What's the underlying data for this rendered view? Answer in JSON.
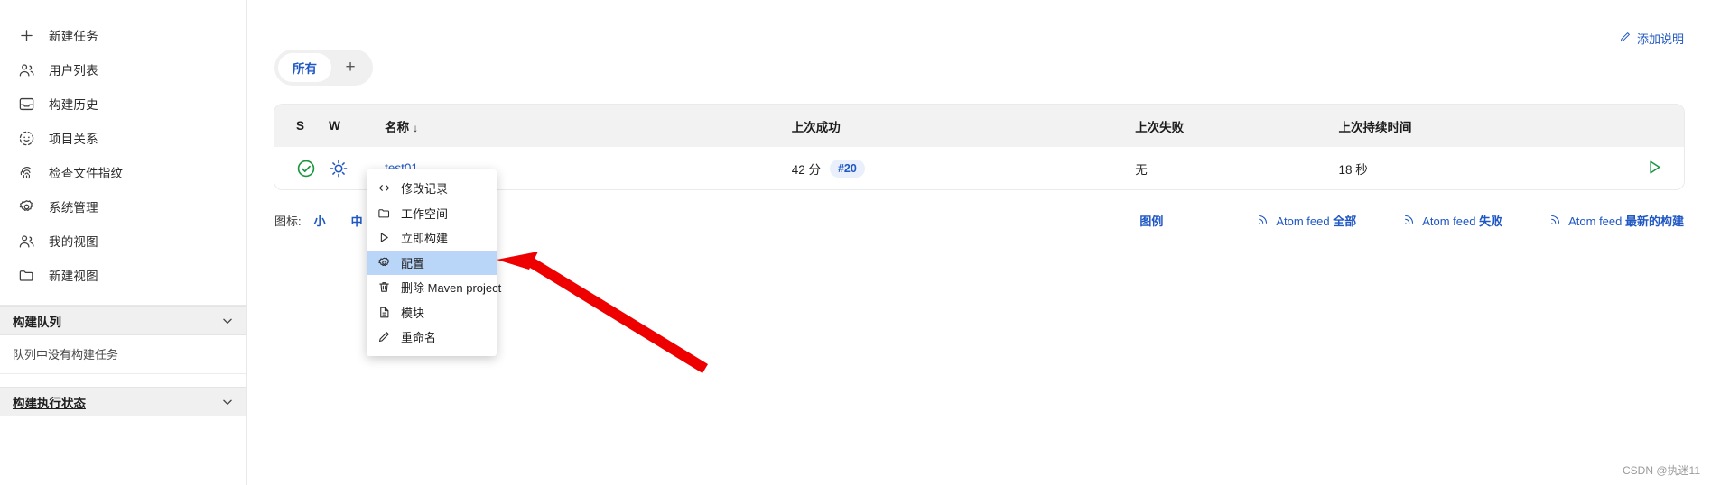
{
  "sidebar": {
    "items": [
      {
        "label": "新建任务",
        "icon": "plus-icon"
      },
      {
        "label": "用户列表",
        "icon": "users-icon"
      },
      {
        "label": "构建历史",
        "icon": "inbox-icon"
      },
      {
        "label": "项目关系",
        "icon": "relations-icon"
      },
      {
        "label": "检查文件指纹",
        "icon": "fingerprint-icon"
      },
      {
        "label": "系统管理",
        "icon": "gear-icon"
      },
      {
        "label": "我的视图",
        "icon": "users-icon"
      },
      {
        "label": "新建视图",
        "icon": "folder-icon"
      }
    ],
    "build_queue": {
      "title": "构建队列",
      "empty_text": "队列中没有构建任务"
    },
    "build_executor": {
      "title": "构建执行状态"
    }
  },
  "main": {
    "add_description": "添加说明",
    "tabs": [
      {
        "label": "所有",
        "active": true
      }
    ],
    "tab_add_label": "+",
    "table": {
      "headers": [
        "S",
        "W",
        "名称",
        "上次成功",
        "上次失败",
        "上次持续时间",
        ""
      ],
      "sort_indicator": "↓",
      "rows": [
        {
          "status_icon": "success-check-icon",
          "weather_icon": "weather-sunny-icon",
          "name": "test01",
          "last_success": "42 分",
          "last_success_build": "#20",
          "last_failure": "无",
          "last_duration": "18 秒",
          "run_icon": "play-icon"
        }
      ]
    },
    "icon_size": {
      "label": "图标:",
      "options": [
        "小",
        "中"
      ]
    },
    "legend_label": "图例",
    "feeds": [
      {
        "prefix": "Atom feed ",
        "name": "全部"
      },
      {
        "prefix": "Atom feed ",
        "name": "失败"
      },
      {
        "prefix": "Atom feed ",
        "name": "最新的构建"
      }
    ]
  },
  "context_menu": {
    "items": [
      {
        "label": "修改记录",
        "icon": "code-icon",
        "selected": false
      },
      {
        "label": "工作空间",
        "icon": "folder-icon",
        "selected": false
      },
      {
        "label": "立即构建",
        "icon": "play-icon",
        "selected": false
      },
      {
        "label": "配置",
        "icon": "gear-icon",
        "selected": true
      },
      {
        "label": "删除 Maven project",
        "icon": "trash-icon",
        "selected": false
      },
      {
        "label": "模块",
        "icon": "document-icon",
        "selected": false
      },
      {
        "label": "重命名",
        "icon": "pencil-icon",
        "selected": false
      }
    ]
  },
  "watermark": "CSDN @执迷11",
  "colors": {
    "accent_blue": "#1f57c3",
    "success_green": "#1a9641",
    "header_grey": "#f2f2f2",
    "menu_selected": "#b9d5f7",
    "annotation_red": "#ee0000"
  }
}
